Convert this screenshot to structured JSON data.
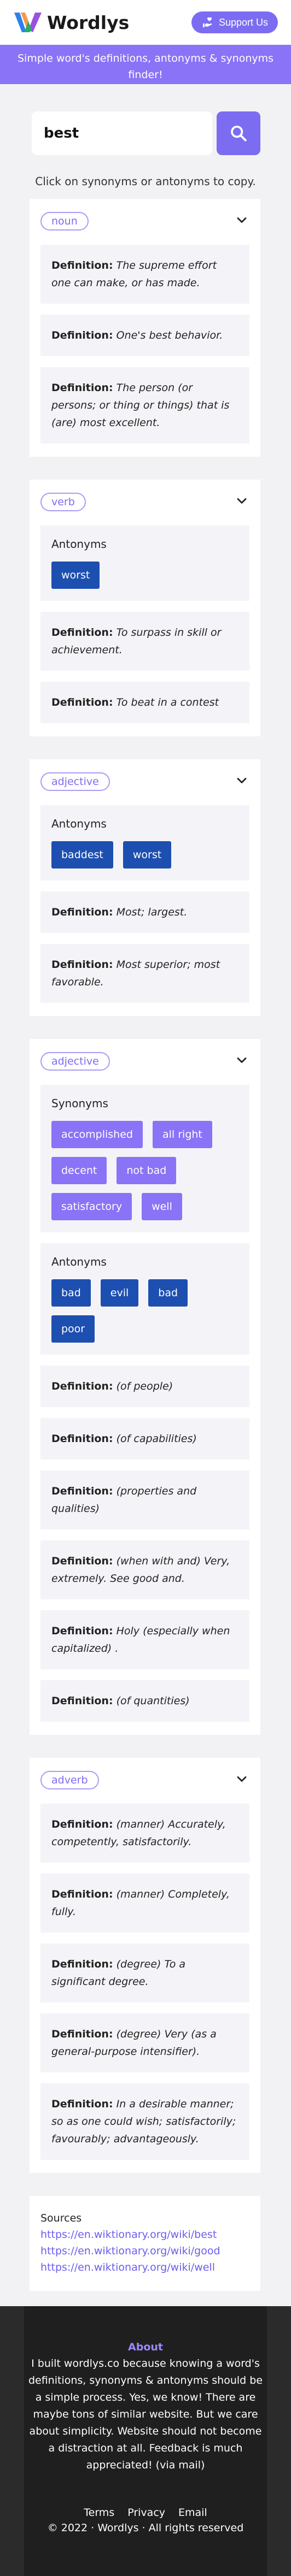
{
  "header": {
    "logo_text": "Wordlys",
    "support_label": "Support Us",
    "banner": "Simple word's definitions, antonyms & synonyms finder!"
  },
  "search": {
    "value": "best",
    "placeholder": ""
  },
  "hint": "Click on synonyms or antonyms to copy.",
  "definition_label": "Definition:",
  "antonyms_title": "Antonyms",
  "synonyms_title": "Synonyms",
  "cards": [
    {
      "pos": "noun",
      "definitions": [
        "The supreme effort one can make, or has made.",
        "One's best behavior.",
        "The person (or persons; or thing or things) that is (are) most excellent."
      ]
    },
    {
      "pos": "verb",
      "antonyms": [
        "worst"
      ],
      "definitions": [
        "To surpass in skill or achievement.",
        "To beat in a contest"
      ]
    },
    {
      "pos": "adjective",
      "antonyms": [
        "baddest",
        "worst"
      ],
      "definitions": [
        "Most; largest.",
        "Most superior; most favorable."
      ]
    },
    {
      "pos": "adjective",
      "synonyms": [
        "accomplished",
        "all right",
        "decent",
        "not bad",
        "satisfactory",
        "well"
      ],
      "antonyms": [
        "bad",
        "evil",
        "bad",
        "poor"
      ],
      "definitions": [
        "(of people)",
        "(of capabilities)",
        "(properties and qualities)",
        "(when with and) Very, extremely. See good and.",
        "Holy (especially when capitalized) .",
        "(of quantities)"
      ]
    },
    {
      "pos": "adverb",
      "definitions": [
        "(manner) Accurately, competently, satisfactorily.",
        "(manner) Completely, fully.",
        "(degree) To a significant degree.",
        "(degree) Very (as a general-purpose intensifier).",
        "In a desirable manner; so as one could wish; satisfactorily; favourably; advantageously."
      ]
    }
  ],
  "sources": {
    "title": "Sources",
    "links": [
      "https://en.wiktionary.org/wiki/best",
      "https://en.wiktionary.org/wiki/good",
      "https://en.wiktionary.org/wiki/well"
    ]
  },
  "footer": {
    "about_title": "About",
    "about_text": "I built wordlys.co because knowing a word's definitions, synonyms & antonyms should be a simple process. Yes, we know! There are maybe tons of similar website. But we care about simplicity. Website should not become a distraction at all. Feedback is much appreciated! (via mail)",
    "links": [
      "Terms",
      "Privacy",
      "Email"
    ],
    "copyright": "© 2022 · Wordlys · All rights reserved"
  },
  "colors": {
    "accent": "#7c6cf2",
    "banner": "#8a73f6",
    "antonym_chip": "#1d4fb0",
    "synonym_chip": "#8a73f6",
    "footer_bg": "#1f1f1f"
  }
}
